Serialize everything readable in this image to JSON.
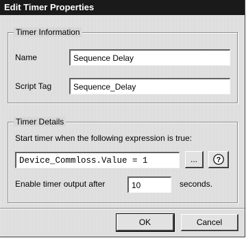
{
  "dialog": {
    "title": "Edit Timer Properties"
  },
  "timer_information": {
    "legend": "Timer Information",
    "name_label": "Name",
    "name_value": "Sequence Delay",
    "script_tag_label": "Script Tag",
    "script_tag_value": "Sequence_Delay"
  },
  "timer_details": {
    "legend": "Timer Details",
    "instruction": "Start timer when the following expression is true:",
    "expression_value": "Device_Commloss.Value = 1",
    "browse_label": "...",
    "help_icon": "help-icon",
    "enable_label": "Enable timer output after",
    "delay_value": "10",
    "units_label": "seconds."
  },
  "buttons": {
    "ok_label": "OK",
    "cancel_label": "Cancel"
  }
}
